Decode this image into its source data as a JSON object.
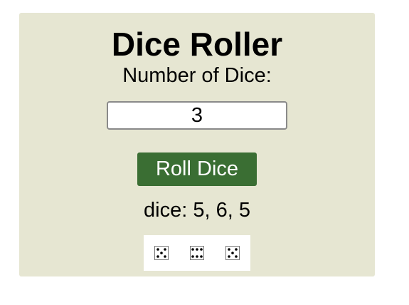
{
  "app": {
    "title": "Dice Roller"
  },
  "controls": {
    "number_label": "Number of Dice:",
    "number_value": "3",
    "roll_button_label": "Roll Dice"
  },
  "result": {
    "text": "dice: 5, 6, 5",
    "faces": [
      5,
      6,
      5
    ]
  },
  "colors": {
    "card_background": "#e6e6d2",
    "button_background": "#3a6e33",
    "button_text": "#ffffff"
  }
}
